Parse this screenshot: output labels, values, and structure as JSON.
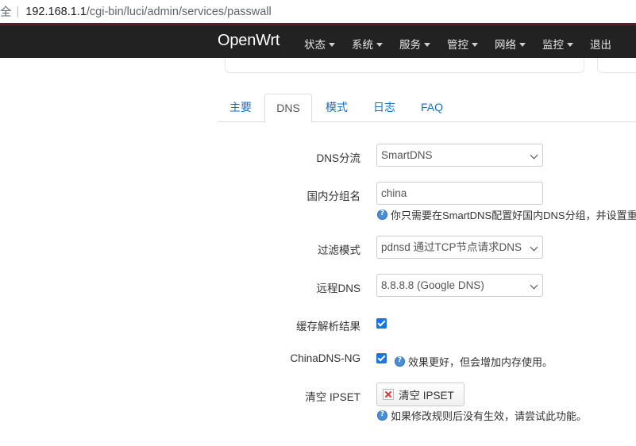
{
  "browser": {
    "address_prefix": "全",
    "address_host": "192.168.1.1",
    "address_path": "/cgi-bin/luci/admin/services/passwall"
  },
  "header": {
    "brand": "OpenWrt",
    "menu": [
      "状态",
      "系统",
      "服务",
      "管控",
      "网络",
      "监控"
    ],
    "logout": "退出"
  },
  "tabs": [
    "主要",
    "DNS",
    "模式",
    "日志",
    "FAQ"
  ],
  "active_tab": "DNS",
  "form": {
    "dns_shunt": {
      "label": "DNS分流",
      "value": "SmartDNS"
    },
    "china_group": {
      "label": "国内分组名",
      "value": "china",
      "help": "你只需要在SmartDNS配置好国内DNS分组，并设置重"
    },
    "filter_mode": {
      "label": "过滤模式",
      "value": "pdnsd 通过TCP节点请求DNS"
    },
    "remote_dns": {
      "label": "远程DNS",
      "value": "8.8.8.8 (Google DNS)"
    },
    "cache": {
      "label": "缓存解析结果",
      "checked": true
    },
    "chinadns_ng": {
      "label": "ChinaDNS-NG",
      "checked": true,
      "help": "效果更好，但会增加内存使用。"
    },
    "clear_ipset": {
      "label": "清空 IPSET",
      "button": "清空 IPSET",
      "help": "如果修改规则后没有生效，请尝试此功能。"
    }
  },
  "colors": {
    "header_bg": "#222222",
    "link": "#1a6ec2",
    "checkbox": "#1a73e8"
  }
}
